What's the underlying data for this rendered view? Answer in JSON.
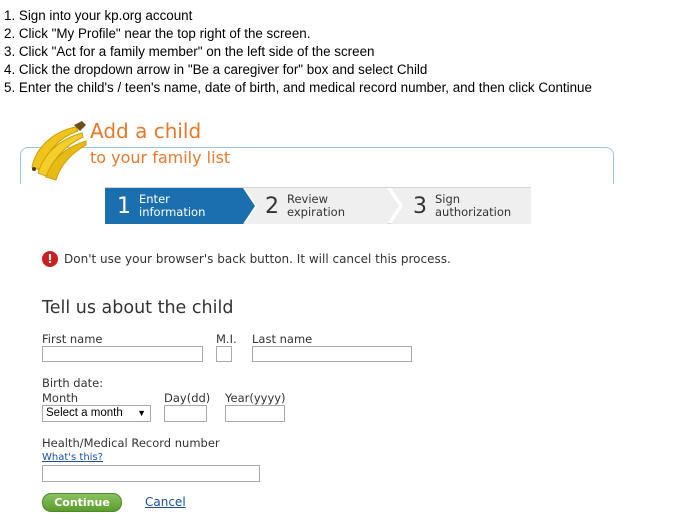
{
  "instructions": [
    "1. Sign into your kp.org account",
    "2. Click \"My Profile\" near the top right of the screen.",
    "3. Click \"Act for a family member\" on the left side of the screen",
    "4. Click the dropdown arrow in \"Be a caregiver for\" box and select Child",
    "5. Enter the child's / teen's name, date of birth, and medical record number, and then click Continue"
  ],
  "header": {
    "title_line1": "Add a child",
    "title_line2": "to your family list",
    "accent_color": "#e8782a"
  },
  "steps": [
    {
      "number": "1",
      "label_line1": "Enter",
      "label_line2": "information",
      "active": true
    },
    {
      "number": "2",
      "label_line1": "Review",
      "label_line2": "expiration",
      "active": false
    },
    {
      "number": "3",
      "label_line1": "Sign",
      "label_line2": "authorization",
      "active": false
    }
  ],
  "warning": {
    "icon": "!",
    "text": "Don't use your browser's back button. It will cancel this process."
  },
  "form": {
    "section_title": "Tell us about the child",
    "first_name_label": "First name",
    "mi_label": "M.I.",
    "last_name_label": "Last name",
    "birth_date_label": "Birth date:",
    "month_label": "Month",
    "month_selected": "Select a month",
    "day_label": "Day(dd)",
    "year_label": "Year(yyyy)",
    "mrn_label": "Health/Medical Record number",
    "whats_this_link": "What's this?"
  },
  "actions": {
    "continue_label": "Continue",
    "cancel_label": "Cancel"
  }
}
